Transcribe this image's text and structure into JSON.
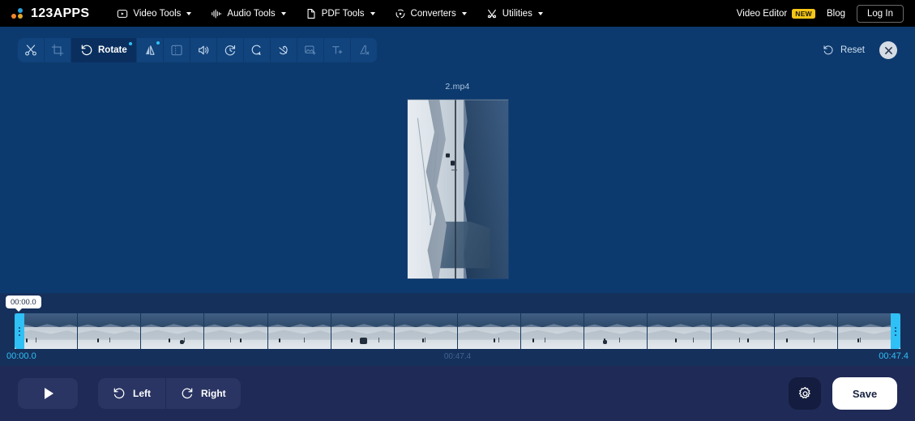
{
  "header": {
    "logo_text": "123APPS",
    "nav": [
      {
        "label": "Video Tools",
        "icon": "video-play-icon"
      },
      {
        "label": "Audio Tools",
        "icon": "audio-wave-icon"
      },
      {
        "label": "PDF Tools",
        "icon": "document-icon"
      },
      {
        "label": "Converters",
        "icon": "convert-arrows-icon"
      },
      {
        "label": "Utilities",
        "icon": "tools-cross-icon"
      }
    ],
    "video_editor_label": "Video Editor",
    "new_badge": "NEW",
    "blog_label": "Blog",
    "login_label": "Log In"
  },
  "toolbar": {
    "tools": [
      {
        "label": "",
        "icon": "scissors-icon",
        "name": "cut",
        "active": false,
        "disabled": false,
        "dot": false
      },
      {
        "label": "",
        "icon": "crop-icon",
        "name": "crop",
        "active": false,
        "disabled": true,
        "dot": false
      },
      {
        "label": "Rotate",
        "icon": "rotate-left-icon",
        "name": "rotate",
        "active": true,
        "disabled": false,
        "dot": true
      },
      {
        "label": "",
        "icon": "flip-icon",
        "name": "flip",
        "active": false,
        "disabled": false,
        "dot": true
      },
      {
        "label": "",
        "icon": "frame-icon",
        "name": "canvas",
        "active": false,
        "disabled": true,
        "dot": false
      },
      {
        "label": "",
        "icon": "volume-icon",
        "name": "volume",
        "active": false,
        "disabled": false,
        "dot": false
      },
      {
        "label": "",
        "icon": "speed-icon",
        "name": "speed",
        "active": false,
        "disabled": false,
        "dot": false
      },
      {
        "label": "",
        "icon": "loop-icon",
        "name": "loop",
        "active": false,
        "disabled": false,
        "dot": false
      },
      {
        "label": "",
        "icon": "stabilize-icon",
        "name": "stabilize",
        "active": false,
        "disabled": false,
        "dot": false
      },
      {
        "label": "",
        "icon": "add-image-icon",
        "name": "add-image",
        "active": false,
        "disabled": true,
        "dot": false
      },
      {
        "label": "",
        "icon": "add-text-icon",
        "name": "add-text",
        "active": false,
        "disabled": true,
        "dot": false
      },
      {
        "label": "",
        "icon": "remove-watermark-icon",
        "name": "remove-watermark",
        "active": false,
        "disabled": true,
        "dot": false
      }
    ],
    "reset_label": "Reset",
    "close_label": "×"
  },
  "preview": {
    "file_name": "2.mp4"
  },
  "timeline": {
    "tooltip_time": "00:00.0",
    "start_time": "00:00.0",
    "mid_time": "00:47.4",
    "end_time": "00:47.4",
    "thumb_count": 14
  },
  "bottom": {
    "play_label": "",
    "rotate_left_label": "Left",
    "rotate_right_label": "Right",
    "settings_label": "",
    "save_label": "Save"
  },
  "colors": {
    "header_bg": "#000000",
    "preview_bg": "#0d3a6e",
    "timeline_bg": "#16305c",
    "bottom_bg": "#1f2a56",
    "accent_cyan": "#2fc0f5",
    "badge_yellow": "#f5c518",
    "save_white": "#ffffff"
  }
}
